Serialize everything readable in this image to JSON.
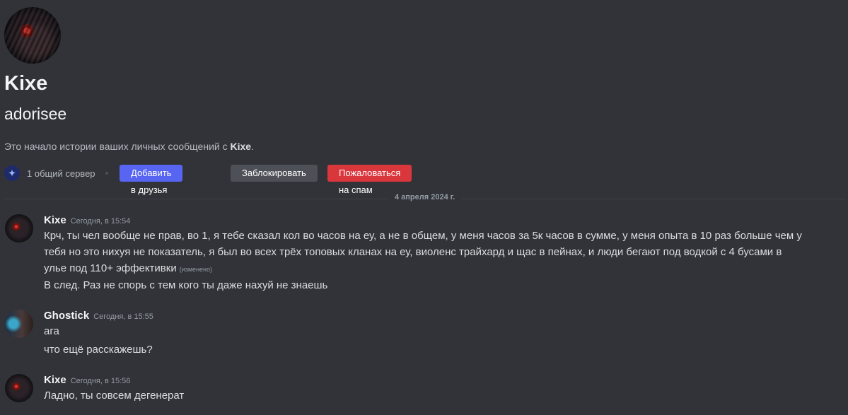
{
  "profile": {
    "display_name": "Kixe",
    "username": "adorisee",
    "intro_prefix": "Это начало истории ваших личных сообщений с ",
    "intro_name": "Kixe",
    "intro_suffix": ".",
    "server_icon": "server-icon",
    "mutual_servers": "1 общий сервер",
    "add_friend_label": "Добавить в друзья",
    "block_label": "Заблокировать",
    "spam_label": "Пожаловаться на спам"
  },
  "divider": {
    "date": "4 апреля 2024 г."
  },
  "messages": [
    {
      "author": "Kixe",
      "timestamp": "Сегодня, в 15:54",
      "lines": [
        "Крч, ты чел вообще не прав, во 1, я тебе сказал кол во часов на еу,  а не в общем, у меня часов за 5к часов в сумме, у меня опыта в 10 раз больше чем у",
        "тебя но это нихуя не показатель, я был во всех трёх топовых кланах на еу, виоленс трайхард и щас в пейнах, и люди бегают под водкой с 4 бусами в",
        "улье под 110+ эффективки",
        "В след. Раз не спорь с тем кого ты даже нахуй не знаешь"
      ],
      "edited": "(изменено)"
    },
    {
      "author": "Ghostick",
      "timestamp": "Сегодня, в 15:55",
      "lines": [
        "ага",
        "что ещё расскажешь?"
      ]
    },
    {
      "author": "Kixe",
      "timestamp": "Сегодня, в 15:56",
      "lines": [
        "Ладно, ты совсем дегенерат"
      ]
    }
  ],
  "colors": {
    "background": "#313338",
    "blurple": "#5865f2",
    "danger": "#da373c",
    "secondary": "#4e5058"
  }
}
